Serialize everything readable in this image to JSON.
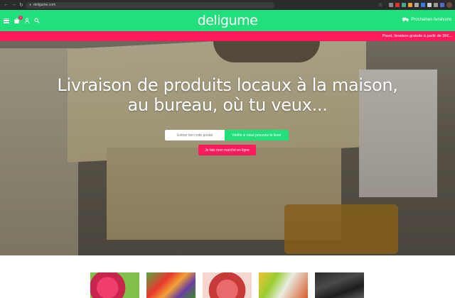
{
  "browser": {
    "url": "deligume.com"
  },
  "header": {
    "logo": "deligume",
    "cart_count": "1",
    "delivery_label": "Prochaines livraisons"
  },
  "promo": {
    "text": "Pssst, livraison gratuite à partir de 39€..."
  },
  "hero": {
    "title_line1": "Livraison de produits locaux à la maison,",
    "title_line2": "au bureau, où tu veux...",
    "postcode_placeholder": "Entrez ton code postal",
    "check_button": "Vérifie si nous pouvons te livrer",
    "market_button": "Je fais mon marché en ligne"
  },
  "colors": {
    "brand_green": "#21e07c",
    "brand_pink": "#ff1a5b"
  }
}
